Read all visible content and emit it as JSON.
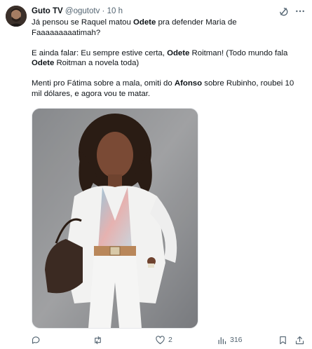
{
  "tweet": {
    "name": "Guto TV",
    "handle": "@ogutotv",
    "separator": "·",
    "time": "10 h",
    "p1": {
      "s1": "Já pensou se Raquel matou ",
      "b1": "Odete",
      "s2": " pra defender Maria de Faaaaaaaaatimah?"
    },
    "p2": {
      "s1": "E ainda falar: Eu sempre estive certa, ",
      "b1": "Odete",
      "s2": " Roitman! (Todo mundo fala ",
      "b2": "Odete",
      "s3": " Roitman a novela toda)"
    },
    "p3": {
      "s1": "Menti pro Fátima sobre a mala, omiti do ",
      "b1": "Afonso",
      "s2": " sobre Rubinho, roubei 10 mil dólares, e agora vou te matar."
    }
  },
  "actions": {
    "likes": "2",
    "views": "316"
  },
  "icons": [
    "avatar",
    "grok-icon",
    "more-icon",
    "reply-icon",
    "retweet-icon",
    "like-icon",
    "views-icon",
    "bookmark-icon",
    "share-icon"
  ],
  "colors": {
    "text": "#0f1419",
    "muted": "#536471"
  }
}
